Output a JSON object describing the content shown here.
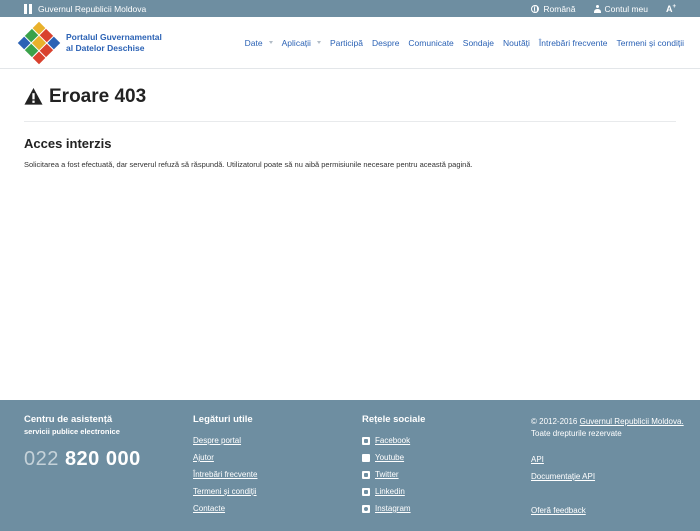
{
  "gov_bar": {
    "title": "Guvernul Republicii Moldova",
    "language": "Română",
    "account": "Contul meu",
    "font_size": "A",
    "font_size_sup": "+"
  },
  "header": {
    "logo_line1": "Portalul Guvernamental",
    "logo_line2": "al Datelor Deschise",
    "logo_colors": [
      "#e9b12b",
      "#d9412e",
      "#2b62b5",
      "#3aa24a",
      "#e9b12b",
      "#d9412e",
      "#2b62b5",
      "#3aa24a",
      "#d9412e"
    ],
    "nav": [
      {
        "label": "Date",
        "dropdown": true
      },
      {
        "label": "Aplicații",
        "dropdown": true
      },
      {
        "label": "Participă",
        "dropdown": false
      },
      {
        "label": "Despre",
        "dropdown": false
      },
      {
        "label": "Comunicate",
        "dropdown": false
      },
      {
        "label": "Sondaje",
        "dropdown": false
      },
      {
        "label": "Noutăți",
        "dropdown": false
      },
      {
        "label": "Întrebări frecvente",
        "dropdown": false
      },
      {
        "label": "Termeni și condiții",
        "dropdown": false
      }
    ]
  },
  "main": {
    "title": "Eroare 403",
    "section_title": "Acces interzis",
    "section_text": "Solicitarea a fost efectuată, dar serverul refuză să răspundă. Utilizatorul poate să nu aibă permisiunile necesare pentru această pagină."
  },
  "footer": {
    "support": {
      "title": "Centru de asistență",
      "subtitle": "servicii publice electronice",
      "phone_prefix": "022",
      "phone_number": "820 000"
    },
    "useful_links": {
      "title": "Legături utile",
      "items": [
        "Despre portal",
        "Ajutor",
        "Întrebări frecvente",
        "Termeni și condiții",
        "Contacte"
      ]
    },
    "social": {
      "title": "Rețele sociale",
      "items": [
        {
          "label": "Facebook",
          "icon": "facebook-icon"
        },
        {
          "label": "Youtube",
          "icon": "youtube-icon"
        },
        {
          "label": "Twitter",
          "icon": "twitter-icon"
        },
        {
          "label": "Linkedin",
          "icon": "linkedin-icon"
        },
        {
          "label": "Instagram",
          "icon": "instagram-icon"
        }
      ]
    },
    "legal": {
      "copyright_prefix": "© 2012-2016",
      "gov_link": "Guvernul Republicii Moldova.",
      "rights": "Toate drepturile rezervate",
      "api": "API",
      "api_docs": "Documentație API",
      "feedback": "Oferă feedback"
    }
  },
  "colors": {
    "bar": "#6e8ea1",
    "link": "#2b62b5"
  }
}
